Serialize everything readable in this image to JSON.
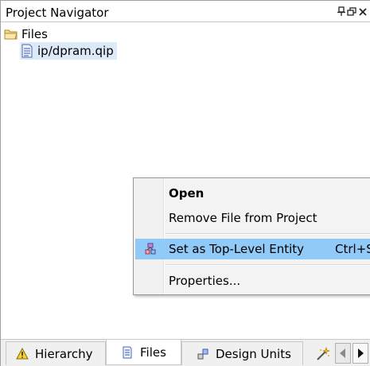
{
  "panel": {
    "title": "Project Navigator"
  },
  "tree": {
    "root_label": "Files",
    "file_label": "ip/dpram.qip"
  },
  "context_menu": {
    "open": "Open",
    "remove": "Remove File from Project",
    "set_top": "Set as Top-Level Entity",
    "set_top_shortcut": "Ctrl+S",
    "properties": "Properties..."
  },
  "tabs": {
    "hierarchy": "Hierarchy",
    "files": "Files",
    "design_units": "Design Units"
  },
  "icons": {
    "folder": "folder-icon",
    "file": "document-icon",
    "pin": "pin-icon",
    "restore": "restore-icon",
    "close": "close-icon",
    "hierarchy": "warning-triangle-icon",
    "design_units": "design-units-icon",
    "wand": "magic-wand-icon",
    "scroll_left": "scroll-left-icon",
    "scroll_right": "scroll-right-icon",
    "entity": "entity-icon"
  },
  "colors": {
    "selection": "#dbe9f8",
    "menu_highlight": "#91c9f7"
  }
}
